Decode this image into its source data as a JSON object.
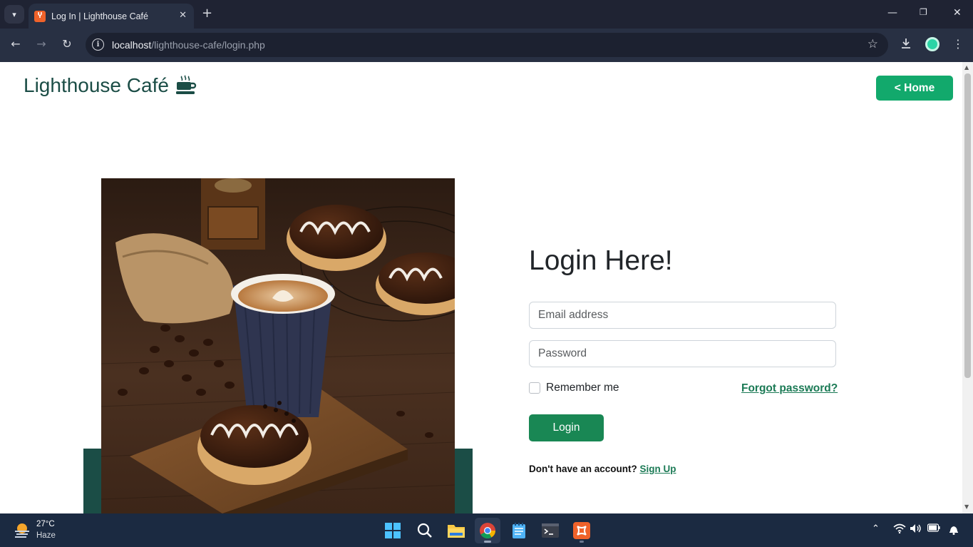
{
  "browser": {
    "tab_title": "Log In | Lighthouse Café",
    "url_host": "localhost",
    "url_path": "/lighthouse-cafe/login.php"
  },
  "page": {
    "brand_name": "Lighthouse Café",
    "home_button": "<  Home",
    "login_title": "Login Here!",
    "email_placeholder": "Email address",
    "password_placeholder": "Password",
    "remember_label": "Remember me",
    "forgot_link": "Forgot password?",
    "login_button": "Login",
    "signup_prompt": "Don't have an account? ",
    "signup_link": "Sign Up"
  },
  "taskbar": {
    "weather_temp": "27°C",
    "weather_desc": "Haze",
    "apps": [
      "start-icon",
      "search-icon",
      "file-explorer-icon",
      "chrome-icon",
      "notepad-icon",
      "terminal-icon",
      "xampp-icon"
    ]
  },
  "colors": {
    "brand": "#1b4d46",
    "home_button": "#12a96c",
    "login_button": "#198754",
    "link": "#1b7a55"
  }
}
